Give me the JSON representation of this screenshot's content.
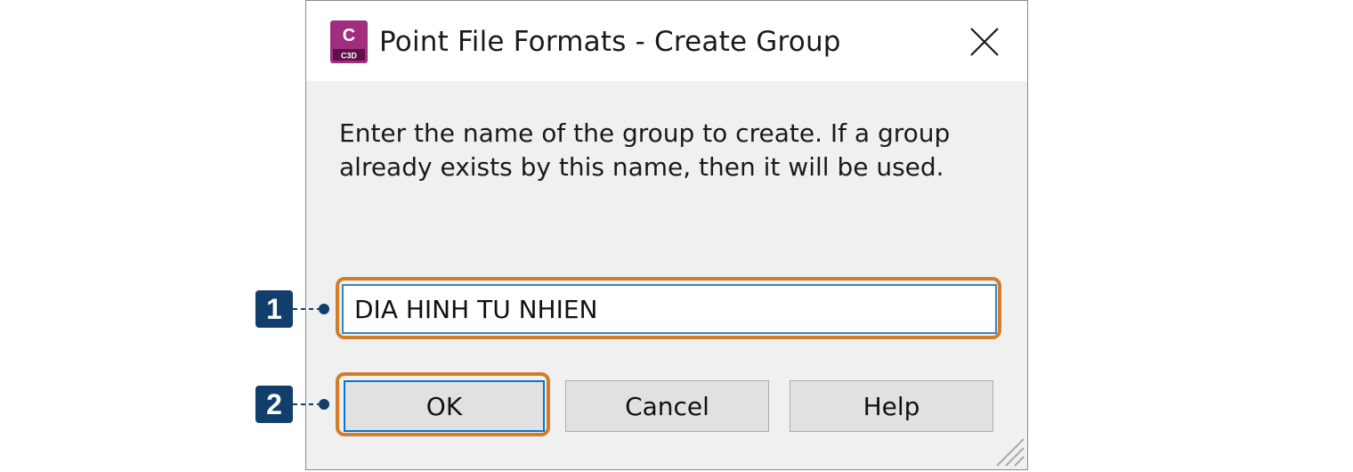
{
  "dialog": {
    "title": "Point File Formats - Create Group",
    "app_icon": {
      "name": "civil-3d-icon",
      "letter": "C",
      "sublabel": "C3D",
      "color": "#a02d7f"
    },
    "close_icon": "close-icon",
    "message_line1": "Enter the name of the group to create.  If a group",
    "message_line2": "already exists by this name, then it will be used.",
    "group_name_value": "DIA HINH TU NHIEN",
    "buttons": {
      "ok": "OK",
      "cancel": "Cancel",
      "help": "Help"
    }
  },
  "annotations": {
    "callout_1": "1",
    "callout_2": "2",
    "highlight_color": "#d17d2a",
    "badge_color": "#123e6c"
  }
}
